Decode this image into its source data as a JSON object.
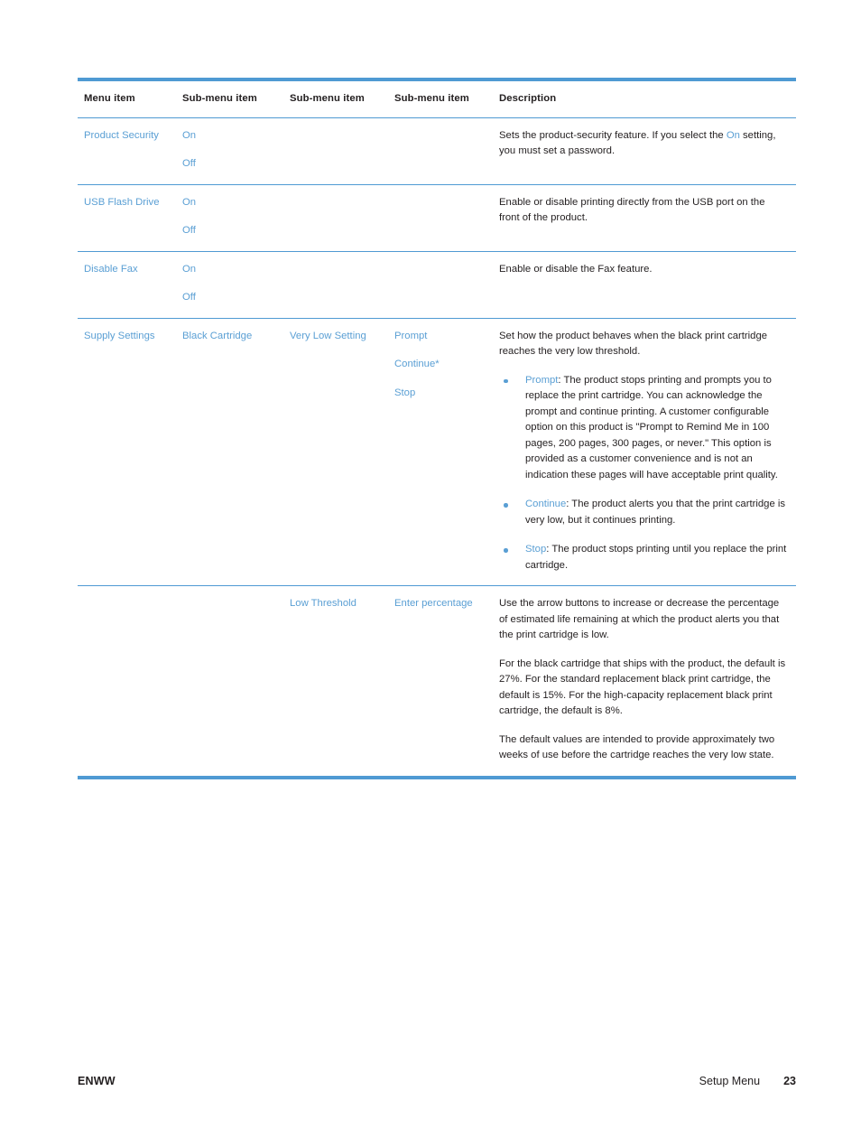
{
  "colors": {
    "link_blue": "#5a9fd4",
    "rule_blue": "#4f9ad3",
    "text": "#231f20"
  },
  "table": {
    "headers": [
      "Menu item",
      "Sub-menu item",
      "Sub-menu item",
      "Sub-menu item",
      "Description"
    ],
    "rows": [
      {
        "menu_item": "Product Security",
        "sub1_options": [
          "On",
          "Off"
        ],
        "sub2_options": [],
        "sub3_options": [],
        "description_parts": [
          {
            "text": "Sets the product-security feature. If you select the "
          },
          {
            "text": "On",
            "style": "blue"
          },
          {
            "text": " setting, you must set a password."
          }
        ]
      },
      {
        "menu_item": "USB Flash Drive",
        "sub1_options": [
          "On",
          "Off"
        ],
        "sub2_options": [],
        "sub3_options": [],
        "description_parts": [
          {
            "text": "Enable or disable printing directly from the USB port on the front of the product."
          }
        ]
      },
      {
        "menu_item": "Disable Fax",
        "sub1_options": [
          "On",
          "Off"
        ],
        "sub2_options": [],
        "sub3_options": [],
        "description_parts": [
          {
            "text": "Enable or disable the Fax feature."
          }
        ]
      },
      {
        "menu_item": "Supply Settings",
        "sub1_options": [
          "Black Cartridge"
        ],
        "sub2_options": [
          "Very Low Setting"
        ],
        "sub3_options": [
          "Prompt",
          "Continue*",
          "Stop"
        ],
        "description_intro": "Set how the product behaves when the black print cartridge reaches the very low threshold.",
        "bullets": [
          {
            "term": "Prompt",
            "body": ": The product stops printing and prompts you to replace the print cartridge. You can acknowledge the prompt and continue printing. A customer configurable option on this product is \"Prompt to Remind Me in 100 pages, 200 pages, 300 pages, or never.\" This option is provided as a customer convenience and is not an indication these pages will have acceptable print quality."
          },
          {
            "term": "Continue",
            "body": ": The product alerts you that the print cartridge is very low, but it continues printing."
          },
          {
            "term": "Stop",
            "body": ": The product stops printing until you replace the print cartridge."
          }
        ]
      },
      {
        "menu_item": "",
        "sub1_options": [],
        "sub2_options": [
          "Low Threshold"
        ],
        "sub3_options": [
          "Enter percentage"
        ],
        "description_paragraphs": [
          "Use the arrow buttons to increase or decrease the percentage of estimated life remaining at which the product alerts you that the print cartridge is low.",
          "For the black cartridge that ships with the product, the default is 27%. For the standard replacement black print cartridge, the default is 15%. For the high-capacity replacement black print cartridge, the default is 8%.",
          "The default values are intended to provide approximately two weeks of use before the cartridge reaches the very low state."
        ]
      }
    ]
  },
  "footer": {
    "left": "ENWW",
    "chapter": "Setup Menu",
    "page_number": "23"
  }
}
